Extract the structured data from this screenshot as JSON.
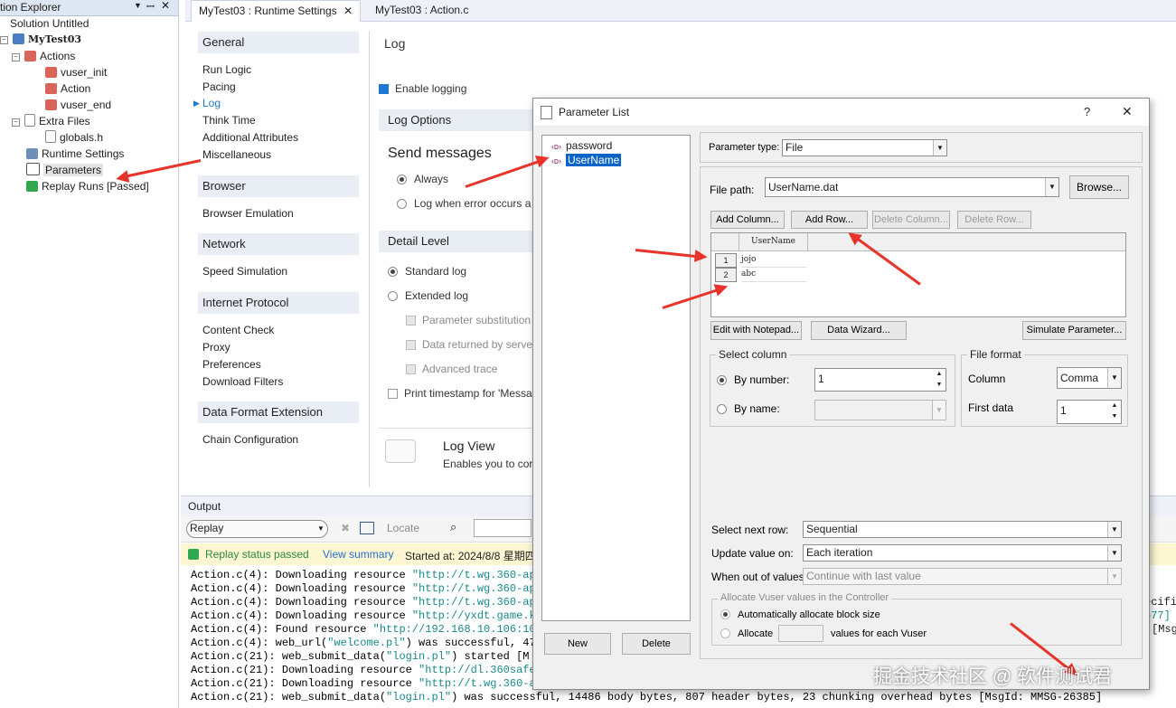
{
  "solution_explorer": {
    "title": "tion Explorer",
    "pin_icon": "pin-icon",
    "items": [
      {
        "label": "Solution Untitled"
      },
      {
        "label": "MyTest03"
      },
      {
        "label": "Actions"
      },
      {
        "label": "vuser_init"
      },
      {
        "label": "Action"
      },
      {
        "label": "vuser_end"
      },
      {
        "label": "Extra Files"
      },
      {
        "label": "globals.h"
      },
      {
        "label": "Runtime Settings"
      },
      {
        "label": "Parameters"
      },
      {
        "label": "Replay Runs [Passed]"
      }
    ]
  },
  "tabs": [
    {
      "label": "MyTest03 : Runtime Settings"
    },
    {
      "label": "MyTest03 : Action.c"
    }
  ],
  "runtime_nav": {
    "general": "General",
    "general_items": [
      "Run Logic",
      "Pacing",
      "Log",
      "Think Time",
      "Additional Attributes",
      "Miscellaneous"
    ],
    "browser": "Browser",
    "browser_items": [
      "Browser Emulation"
    ],
    "network": "Network",
    "network_items": [
      "Speed Simulation"
    ],
    "internet": "Internet Protocol",
    "internet_items": [
      "Content Check",
      "Proxy",
      "Preferences",
      "Download Filters"
    ],
    "dfe": "Data Format Extension",
    "dfe_items": [
      "Chain Configuration"
    ]
  },
  "log_panel": {
    "title": "Log",
    "enable_logging": "Enable logging",
    "log_options": "Log Options",
    "send_messages": "Send messages",
    "always": "Always",
    "log_when_error": "Log when error occurs a",
    "detail_level": "Detail Level",
    "standard_log": "Standard log",
    "extended_log": "Extended log",
    "param_sub": "Parameter substitution",
    "data_returned": "Data returned by serve",
    "advanced_trace": "Advanced trace",
    "print_timestamp": "Print timestamp for 'Messa",
    "log_view_title": "Log View",
    "log_view_desc": "Enables you to cor"
  },
  "output": {
    "title": "Output",
    "filter": "Replay",
    "locate": "Locate",
    "status": "Replay status passed",
    "view_summary": "View summary",
    "started": "Started at: 2024/8/8 星期四",
    "lines": [
      {
        "pre": "Action.c(4): Downloading resource ",
        "str": "\"http://t.wg.360-api",
        "post": ""
      },
      {
        "pre": "Action.c(4): Downloading resource ",
        "str": "\"http://t.wg.360-api",
        "post": ""
      },
      {
        "pre": "Action.c(4): Downloading resource ",
        "str": "\"http://t.wg.360-api",
        "post": ""
      },
      {
        "pre": "Action.c(4): Downloading resource ",
        "str": "\"http://yxdt.game.ke",
        "post": ""
      },
      {
        "pre": "Action.c(4): Found resource ",
        "str": "\"http://192.168.10.106:108",
        "post": ""
      },
      {
        "pre": "Action.c(4): web_url(",
        "str": "\"welcome.pl\"",
        "post": ") was successful, 476"
      },
      {
        "pre": "Action.c(21): web_submit_data(",
        "str": "\"login.pl\"",
        "post": ") started   [M"
      },
      {
        "pre": "Action.c(21): Downloading resource ",
        "str": "\"http://dl.360safe.",
        "post": ""
      },
      {
        "pre": "Action.c(21): Downloading resource ",
        "str": "\"http://t.wg.360-ap",
        "post": ""
      },
      {
        "pre": "Action.c(21): web_submit_data(",
        "str": "\"login.pl\"",
        "post": ") was successful, 14486 body bytes, 807 header bytes, 23 chunking overhead bytes    [MsgId: MMSG-26385]"
      }
    ],
    "right_fragments": [
      "ecifi",
      "577]",
      "[Msg"
    ]
  },
  "dialog": {
    "title": "Parameter List",
    "help": "?",
    "close": "✕",
    "params": [
      "password",
      "UserName"
    ],
    "new_btn": "New",
    "delete_btn": "Delete",
    "param_type_label": "Parameter type:",
    "param_type": "File",
    "file_path_label": "File path:",
    "file_path": "UserName.dat",
    "browse": "Browse...",
    "add_column": "Add Column...",
    "add_row": "Add Row...",
    "delete_column": "Delete Column...",
    "delete_row": "Delete Row...",
    "grid_header": "UserName",
    "grid_rows": [
      {
        "num": "1",
        "value": "jojo"
      },
      {
        "num": "2",
        "value": "abc"
      }
    ],
    "edit_notepad": "Edit with Notepad...",
    "data_wizard": "Data Wizard...",
    "simulate": "Simulate Parameter...",
    "select_column": "Select column",
    "by_number": "By number:",
    "by_number_value": "1",
    "by_name": "By name:",
    "file_format": "File format",
    "column_label": "Column",
    "column_value": "Comma",
    "first_data_label": "First data",
    "first_data_value": "1",
    "select_next_row_label": "Select next row:",
    "select_next_row": "Sequential",
    "update_value_label": "Update value on:",
    "update_value": "Each iteration",
    "out_of_values_label": "When out of values:",
    "out_of_values": "Continue with last value",
    "allocate_group": "Allocate Vuser values in the Controller",
    "auto_allocate": "Automatically allocate block size",
    "allocate": "Allocate",
    "values_each": "values for each Vuser"
  },
  "watermark": "掘金技术社区 @ 软件测试君"
}
